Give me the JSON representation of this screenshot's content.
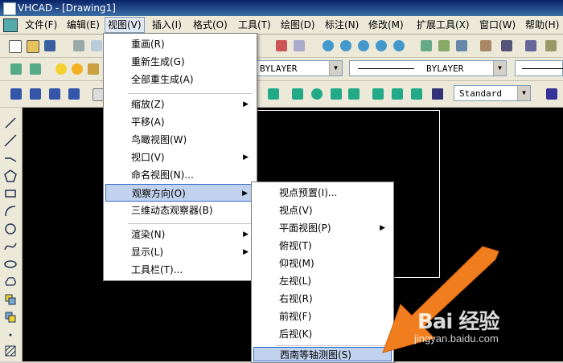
{
  "window": {
    "title": "VHCAD - [Drawing1]"
  },
  "menubar": [
    {
      "label": "文件(F)"
    },
    {
      "label": "编辑(E)"
    },
    {
      "label": "视图(V)"
    },
    {
      "label": "插入(I)"
    },
    {
      "label": "格式(O)"
    },
    {
      "label": "工具(T)"
    },
    {
      "label": "绘图(D)"
    },
    {
      "label": "标注(N)"
    },
    {
      "label": "修改(M)"
    },
    {
      "label": "扩展工具(X)"
    },
    {
      "label": "窗口(W)"
    },
    {
      "label": "帮助(H)"
    }
  ],
  "layer_toolbar": {
    "linetype": "BYLAYER",
    "lineweight": "BYLAYER"
  },
  "style_toolbar": {
    "text_style": "Standard"
  },
  "view_menu": [
    {
      "label": "重画(R)"
    },
    {
      "label": "重新生成(G)"
    },
    {
      "label": "全部重生成(A)"
    },
    {
      "label": "缩放(Z)"
    },
    {
      "label": "平移(A)"
    },
    {
      "label": "鸟瞰视图(W)"
    },
    {
      "label": "视口(V)"
    },
    {
      "label": "命名视图(N)..."
    },
    {
      "label": "观察方向(O)"
    },
    {
      "label": "三维动态观察器(B)"
    },
    {
      "label": "渲染(N)"
    },
    {
      "label": "显示(L)"
    },
    {
      "label": "工具栏(T)..."
    }
  ],
  "view_direction_submenu": [
    {
      "label": "视点预置(I)..."
    },
    {
      "label": "视点(V)"
    },
    {
      "label": "平面视图(P)"
    },
    {
      "label": "俯视(T)"
    },
    {
      "label": "仰视(M)"
    },
    {
      "label": "左视(L)"
    },
    {
      "label": "右视(R)"
    },
    {
      "label": "前视(F)"
    },
    {
      "label": "后视(K)"
    },
    {
      "label": "西南等轴测图(S)"
    }
  ],
  "watermark": {
    "logo": "Bai 经验",
    "url": "jingyan.baidu.com"
  },
  "colors": {
    "canvas": "#000000",
    "menu_highlight": "#c1d2ee",
    "arrow": "#f07e1e"
  }
}
